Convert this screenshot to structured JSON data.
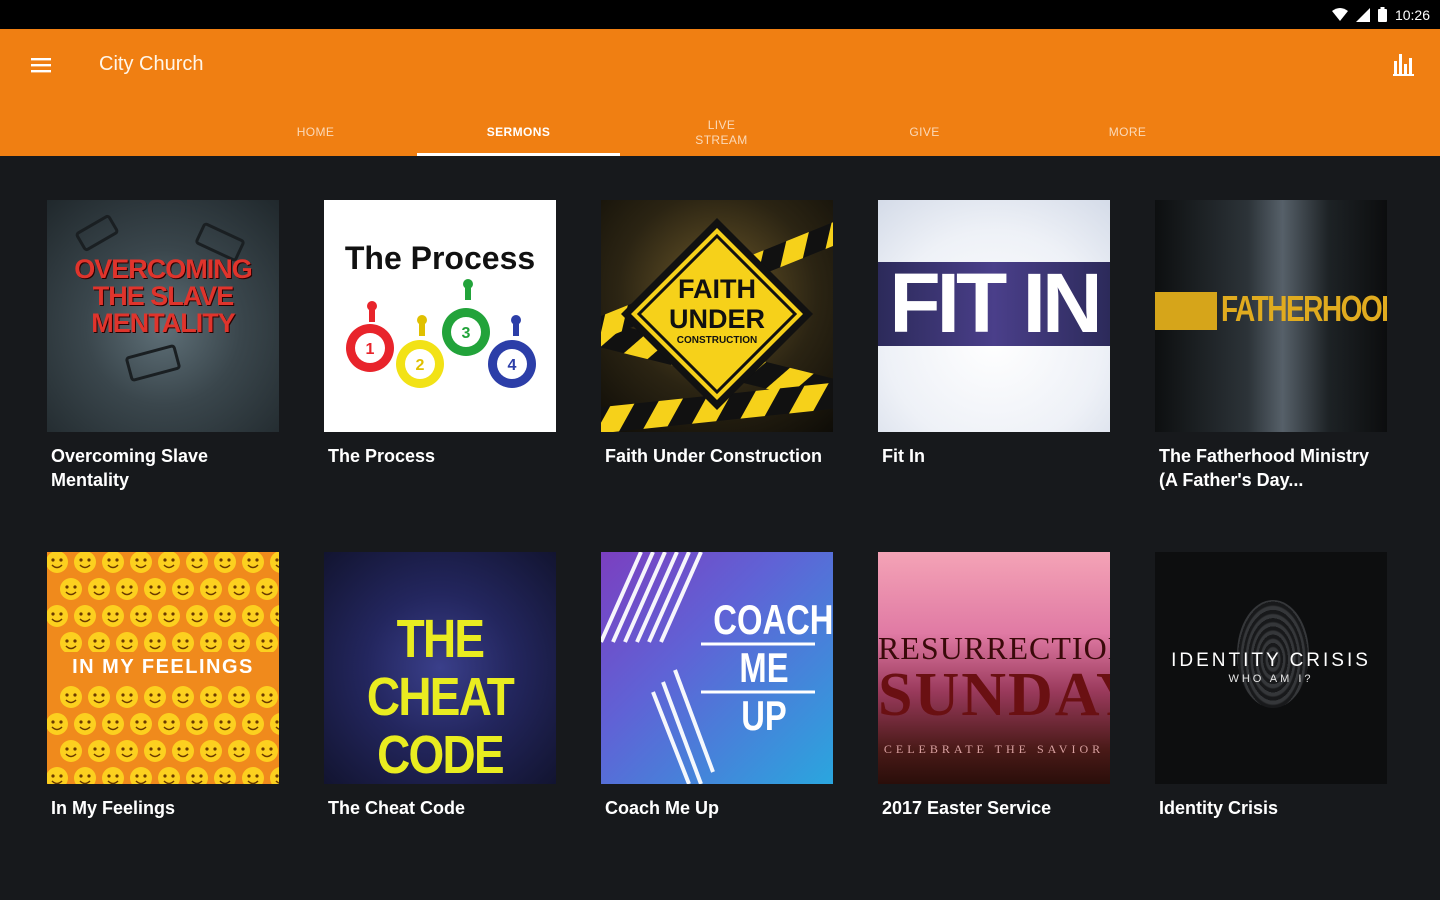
{
  "status_bar": {
    "time": "10:26"
  },
  "app_bar": {
    "title": "City Church",
    "background_color": "#f07f12"
  },
  "tabs": [
    {
      "label": "HOME",
      "active": false
    },
    {
      "label": "SERMONS",
      "active": true
    },
    {
      "label": "LIVE\nSTREAM",
      "active": false
    },
    {
      "label": "GIVE",
      "active": false
    },
    {
      "label": "MORE",
      "active": false
    }
  ],
  "sermons": [
    {
      "title": "Overcoming Slave Mentality",
      "art_text": [
        "OVERCOMING",
        "THE SLAVE",
        "MENTALITY"
      ]
    },
    {
      "title": "The Process",
      "art_text": [
        "The Process"
      ],
      "art_numbers": [
        "1",
        "2",
        "3",
        "4"
      ]
    },
    {
      "title": "Faith Under Construction",
      "art_text": [
        "FAITH",
        "UNDER",
        "CONSTRUCTION"
      ]
    },
    {
      "title": "Fit In",
      "art_text": [
        "FIT IN"
      ]
    },
    {
      "title": "The Fatherhood Ministry (A Father's Day...",
      "art_text": [
        "FATHERHOOD"
      ]
    },
    {
      "title": "In My Feelings",
      "art_text": [
        "IN MY FEELINGS"
      ]
    },
    {
      "title": "The Cheat Code",
      "art_text": [
        "THE CHEAT",
        "CODE"
      ]
    },
    {
      "title": "Coach Me Up",
      "art_text": [
        "COACH",
        "ME",
        "UP"
      ]
    },
    {
      "title": "2017 Easter Service",
      "art_text": [
        "RESURRECTION",
        "SUNDAY",
        "CELEBRATE THE SAVIOR"
      ]
    },
    {
      "title": "Identity Crisis",
      "art_text": [
        "IDENTITY CRISIS",
        "WHO AM I?"
      ]
    }
  ]
}
